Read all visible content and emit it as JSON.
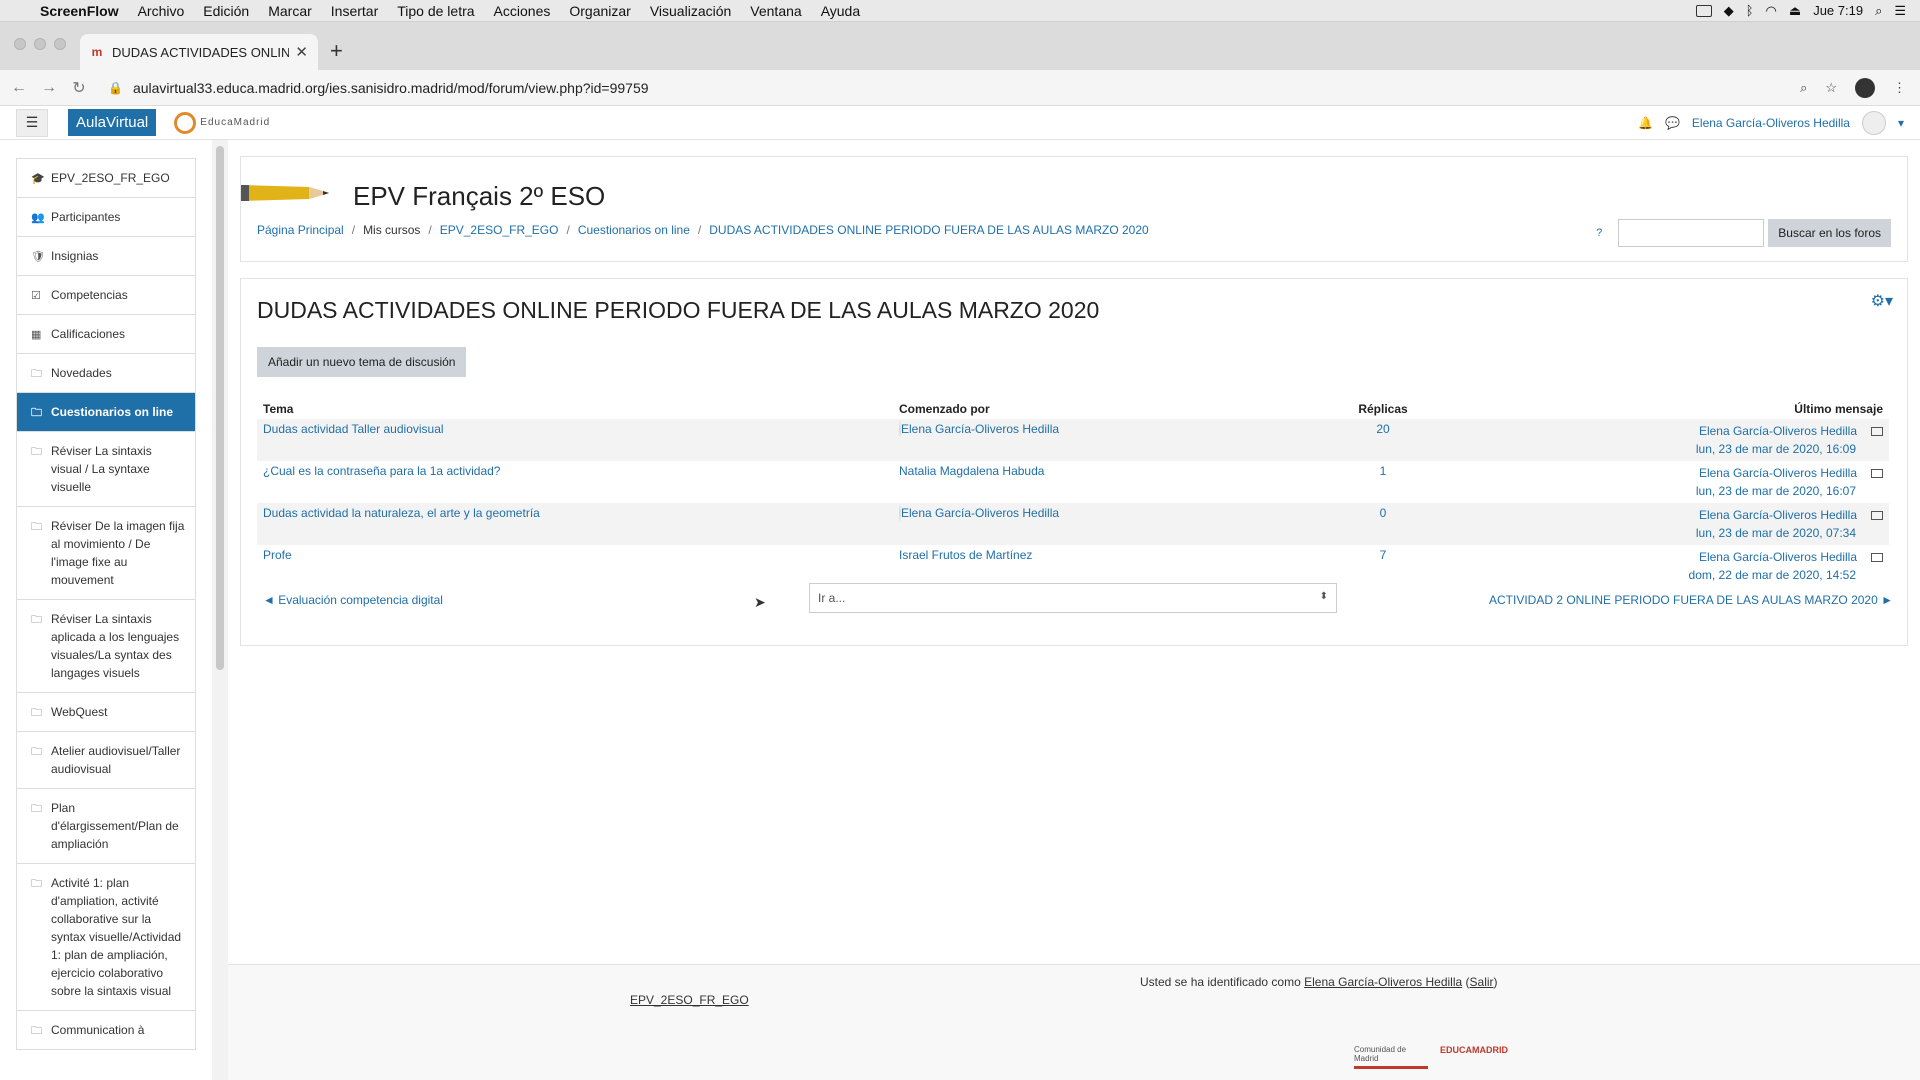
{
  "menubar": {
    "app": "ScreenFlow",
    "items": [
      "Archivo",
      "Edición",
      "Marcar",
      "Insertar",
      "Tipo de letra",
      "Acciones",
      "Organizar",
      "Visualización",
      "Ventana",
      "Ayuda"
    ],
    "clock": "Jue 7:19"
  },
  "browser": {
    "tab_title": "DUDAS ACTIVIDADES ONLINE",
    "url": "aulavirtual33.educa.madrid.org/ies.sanisidro.madrid/mod/forum/view.php?id=99759"
  },
  "navbar": {
    "brand": "AulaVirtual",
    "logo": "EducaMadrid",
    "user": "Elena García-Oliveros Hedilla"
  },
  "sidebar": {
    "items": [
      {
        "label": "EPV_2ESO_FR_EGO",
        "icon": "graduation-cap-icon",
        "glyph": "🎓",
        "active": false
      },
      {
        "label": "Participantes",
        "icon": "users-icon",
        "glyph": "👥",
        "active": false
      },
      {
        "label": "Insignias",
        "icon": "shield-icon",
        "glyph": "🛡",
        "active": false
      },
      {
        "label": "Competencias",
        "icon": "checkbox-icon",
        "glyph": "☑",
        "active": false
      },
      {
        "label": "Calificaciones",
        "icon": "table-icon",
        "glyph": "▦",
        "active": false
      },
      {
        "label": "Novedades",
        "icon": "folder-icon",
        "glyph": "🗀",
        "active": false
      },
      {
        "label": "Cuestionarios on line",
        "icon": "folder-icon",
        "glyph": "🗀",
        "active": true
      },
      {
        "label": "Réviser La sintaxis visual / La syntaxe visuelle",
        "icon": "folder-icon",
        "glyph": "🗀",
        "active": false
      },
      {
        "label": "Réviser De la imagen fija al movimiento / De l'image fixe au mouvement",
        "icon": "folder-icon",
        "glyph": "🗀",
        "active": false
      },
      {
        "label": "Réviser La sintaxis aplicada a los lenguajes visuales/La syntax des langages visuels",
        "icon": "folder-icon",
        "glyph": "🗀",
        "active": false
      },
      {
        "label": "WebQuest",
        "icon": "folder-icon",
        "glyph": "🗀",
        "active": false
      },
      {
        "label": "Atelier audiovisuel/Taller audiovisual",
        "icon": "folder-icon",
        "glyph": "🗀",
        "active": false
      },
      {
        "label": "Plan d'élargissement/Plan de ampliación",
        "icon": "folder-icon",
        "glyph": "🗀",
        "active": false
      },
      {
        "label": "Activité 1: plan d'ampliation, activité collaborative sur la syntax visuelle/Actividad 1: plan de ampliación, ejercicio colaborativo sobre la sintaxis visual",
        "icon": "folder-icon",
        "glyph": "🗀",
        "active": false
      },
      {
        "label": "Communication à",
        "icon": "folder-icon",
        "glyph": "🗀",
        "active": false
      }
    ]
  },
  "course": {
    "title": "EPV Français 2º ESO",
    "search_button": "Buscar en los foros",
    "breadcrumb": [
      "Página Principal",
      "Mis cursos",
      "EPV_2ESO_FR_EGO",
      "Cuestionarios on line",
      "DUDAS ACTIVIDADES ONLINE PERIODO FUERA DE LAS AULAS MARZO 2020"
    ]
  },
  "forum": {
    "title": "DUDAS ACTIVIDADES ONLINE PERIODO FUERA DE LAS AULAS MARZO 2020",
    "add_button": "Añadir un nuevo tema de discusión",
    "columns": {
      "topic": "Tema",
      "started": "Comenzado por",
      "replies": "Réplicas",
      "last": "Último mensaje"
    },
    "rows": [
      {
        "topic": "Dudas actividad Taller audiovisual",
        "author": "Elena García-Oliveros Hedilla",
        "avatar": "blank",
        "replies": "20",
        "last_author": "Elena García-Oliveros Hedilla",
        "last_date": "lun, 23 de mar de 2020, 16:09"
      },
      {
        "topic": "¿Cual es la contraseña para la 1a actividad?",
        "author": "Natalia Magdalena Habuda",
        "avatar": "face",
        "replies": "1",
        "last_author": "Elena García-Oliveros Hedilla",
        "last_date": "lun, 23 de mar de 2020, 16:07"
      },
      {
        "topic": "Dudas actividad la naturaleza, el arte y la geometría",
        "author": "Elena García-Oliveros Hedilla",
        "avatar": "blank",
        "replies": "0",
        "last_author": "Elena García-Oliveros Hedilla",
        "last_date": "lun, 23 de mar de 2020, 07:34"
      },
      {
        "topic": "Profe",
        "author": "Israel Frutos de Martínez",
        "avatar": "globe",
        "replies": "7",
        "last_author": "Elena García-Oliveros Hedilla",
        "last_date": "dom, 22 de mar de 2020, 14:52"
      }
    ],
    "prev": "◄ Evaluación competencia digital",
    "jump": "Ir a...",
    "next": "ACTIVIDAD 2 ONLINE PERIODO FUERA DE LAS AULAS MARZO 2020 ►"
  },
  "footer": {
    "prefix": "Usted se ha identificado como",
    "user": "Elena García-Oliveros Hedilla",
    "logout": "Salir",
    "course": "EPV_2ESO_FR_EGO",
    "logo1": "Comunidad de Madrid",
    "logo2": "EDUCAMADRID"
  }
}
